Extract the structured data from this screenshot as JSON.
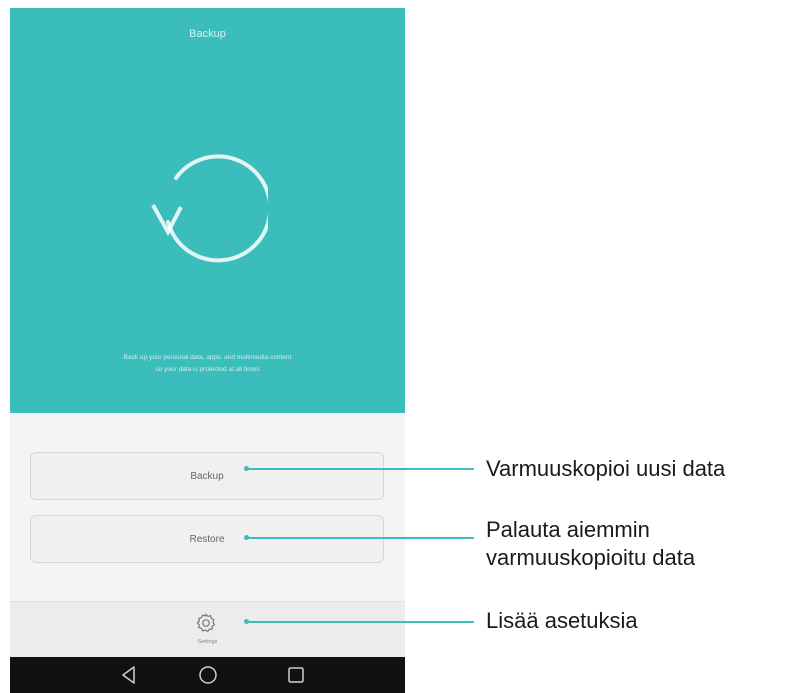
{
  "app": {
    "title": "Backup",
    "description_line1": "Back up your personal data, apps, and multimedia content",
    "description_line2": "so your data is protected at all times"
  },
  "buttons": {
    "backup_label": "Backup",
    "restore_label": "Restore"
  },
  "settings": {
    "label": "Settings"
  },
  "callouts": {
    "backup": "Varmuuskopioi uusi data",
    "restore_line1": "Palauta aiemmin",
    "restore_line2": "varmuuskopioitu data",
    "settings": "Lisää asetuksia"
  },
  "colors": {
    "accent": "#3bbdbc",
    "navbar": "#111111",
    "panel": "#f4f4f4"
  },
  "icons": {
    "hero": "refresh-icon",
    "settings": "gear-icon",
    "nav": [
      "back-icon",
      "home-icon",
      "recent-apps-icon"
    ]
  }
}
